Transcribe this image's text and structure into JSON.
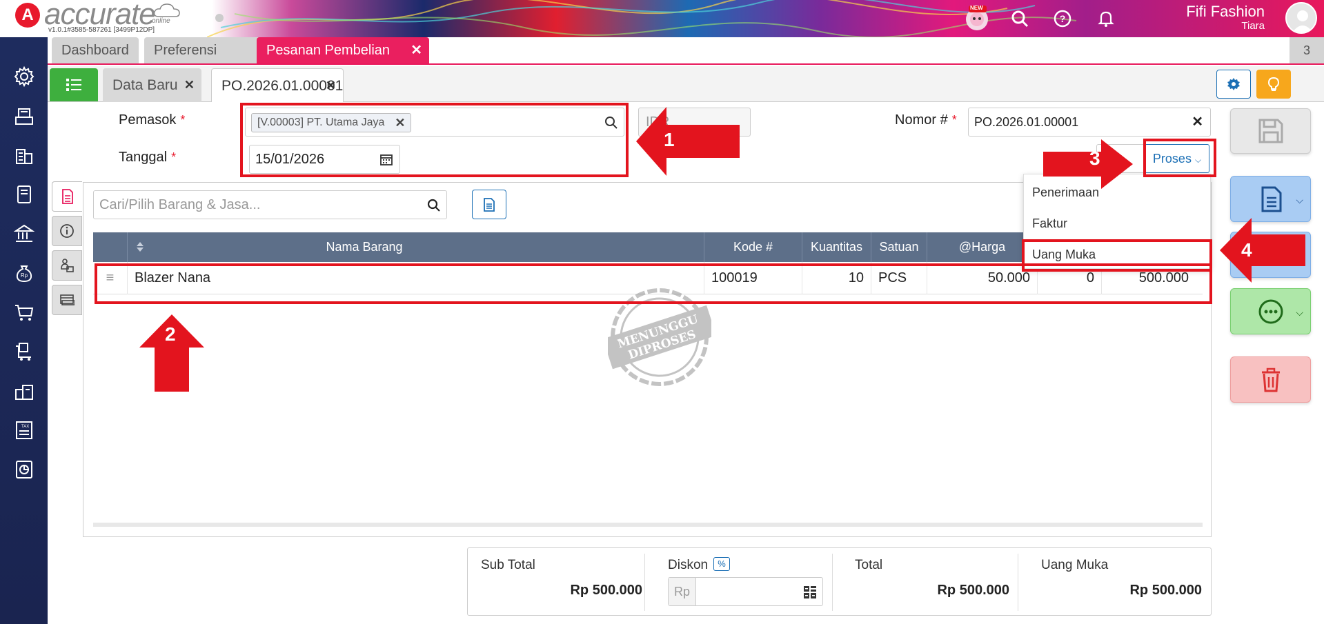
{
  "header": {
    "brand": "accurate",
    "brand_sub": "online",
    "version": "v1.0.1#3585-587261 [3499P12DP]",
    "new_badge": "NEW",
    "user_name": "Fifi Fashion",
    "user_sub": "Tiara"
  },
  "module_tabs": [
    {
      "label": "Dashboard"
    },
    {
      "label": "Preferensi"
    },
    {
      "label": "Pesanan Pembelian"
    }
  ],
  "tab_count": "3",
  "sub_tabs": [
    {
      "label": "Data Baru"
    },
    {
      "label": "PO.2026.01.00001"
    }
  ],
  "form": {
    "supplier_label": "Pemasok",
    "supplier_value": "[V.00003] PT. Utama Jaya",
    "date_label": "Tanggal",
    "date_value": "15/01/2026",
    "currency_value": "IDR",
    "nomor_label": "Nomor #",
    "nomor_value": "PO.2026.01.00001",
    "required_mark": "*",
    "proses_label": "Proses"
  },
  "search": {
    "placeholder": "Cari/Pilih Barang & Jasa..."
  },
  "table": {
    "headers": [
      "Nama Barang",
      "Kode #",
      "Kuantitas",
      "Satuan",
      "@Harga"
    ],
    "rows": [
      {
        "name": "Blazer Nana",
        "code": "100019",
        "qty": "10",
        "unit": "PCS",
        "price": "50.000",
        "discount": "0",
        "total": "500.000"
      }
    ]
  },
  "stamp": {
    "line1": "MENUNGGU",
    "line2": "DIPROSES"
  },
  "proses_menu": [
    "Penerimaan",
    "Faktur",
    "Uang Muka"
  ],
  "totals": {
    "subtotal_label": "Sub Total",
    "subtotal_value": "Rp 500.000",
    "discount_label": "Diskon",
    "discount_pct": "%",
    "discount_currency": "Rp",
    "total_label": "Total",
    "total_value": "Rp 500.000",
    "dp_label": "Uang Muka",
    "dp_value": "Rp 500.000"
  },
  "annotations": [
    "1",
    "2",
    "3",
    "4"
  ],
  "colors": {
    "accent": "#ea1f5f",
    "nav": "#1e2c5e",
    "primary": "#1b6fb5",
    "annotation": "#e3141e"
  }
}
